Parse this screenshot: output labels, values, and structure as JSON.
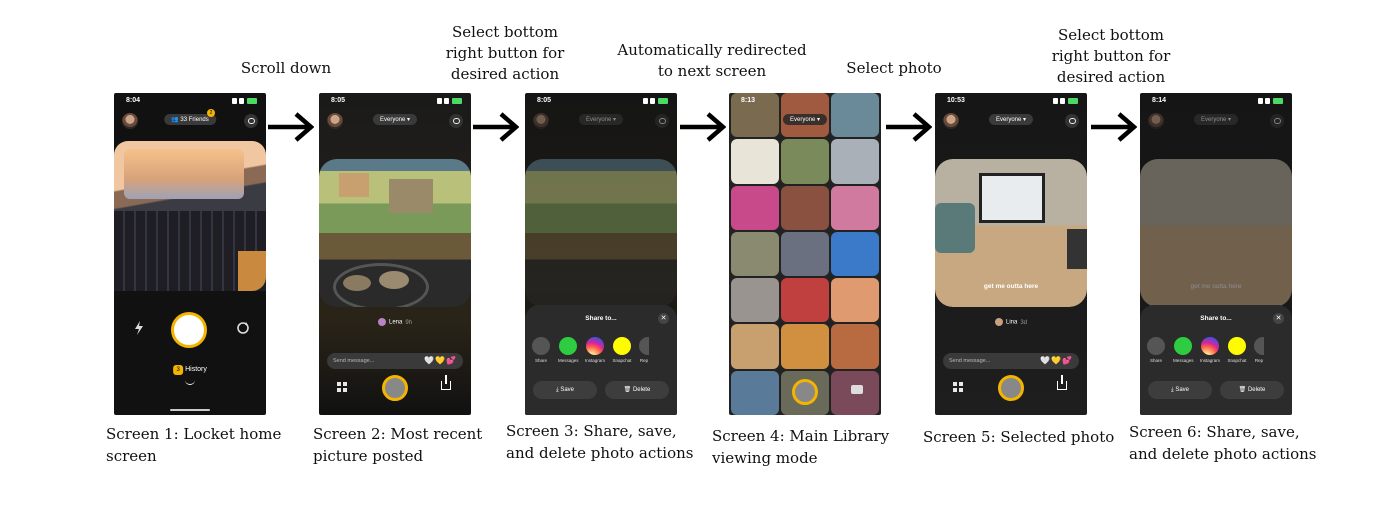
{
  "step_labels": [
    {
      "text": "Scroll down"
    },
    {
      "lines": [
        "Select bottom",
        "right button for",
        "desired action"
      ]
    },
    {
      "lines": [
        "Automatically redirected",
        "to next screen"
      ]
    },
    {
      "text": "Select photo"
    },
    {
      "lines": [
        "Select bottom",
        "right button for",
        "desired action"
      ]
    }
  ],
  "captions": [
    {
      "lines": [
        "Screen 1: Locket home",
        "screen"
      ]
    },
    {
      "lines": [
        "Screen 2: Most recent",
        "picture posted"
      ]
    },
    {
      "lines": [
        "Screen 3: Share, save,",
        "and delete photo actions"
      ]
    },
    {
      "lines": [
        "Screen 4: Main Library",
        "viewing mode"
      ]
    },
    {
      "lines": [
        "Screen 5: Selected photo"
      ]
    },
    {
      "lines": [
        "Screen 6: Share, save,",
        "and delete photo actions"
      ]
    }
  ],
  "screens": {
    "s1": {
      "time": "8:04",
      "friends": "33 Friends",
      "badge": "2",
      "history_count": "3",
      "history": "History"
    },
    "s2": {
      "time": "8:05",
      "audience": "Everyone",
      "sender": "Lena",
      "ago": "9h",
      "message_placeholder": "Send message...",
      "emojis": "🤍💛💕"
    },
    "s3": {
      "time": "8:05",
      "audience": "Everyone",
      "share_title": "Share to...",
      "apps": [
        "Share",
        "Messages",
        "Instagram",
        "Snapchat",
        "Rep"
      ],
      "save": "Save",
      "delete": "Delete"
    },
    "s4": {
      "time": "8:13",
      "audience": "Everyone"
    },
    "s5": {
      "time": "10:53",
      "audience": "Everyone",
      "photo_caption": "get me outta here",
      "sender": "Lina",
      "ago": "3d",
      "message_placeholder": "Send message...",
      "emojis": "🤍💛💕"
    },
    "s6": {
      "time": "8:14",
      "audience": "Everyone",
      "photo_caption": "get me outta here",
      "share_title": "Share to...",
      "apps": [
        "Share",
        "Messages",
        "Instagram",
        "Snapchat",
        "Rep"
      ],
      "save": "Save",
      "delete": "Delete"
    }
  },
  "colors": {
    "accent": "#f4b400",
    "messages": "#2ecc40",
    "snapchat": "#fffc00"
  },
  "icons": [
    "arrow-right-icon",
    "lightning-icon",
    "flip-camera-icon",
    "chat-icon",
    "grid-icon",
    "share-icon",
    "close-icon"
  ]
}
